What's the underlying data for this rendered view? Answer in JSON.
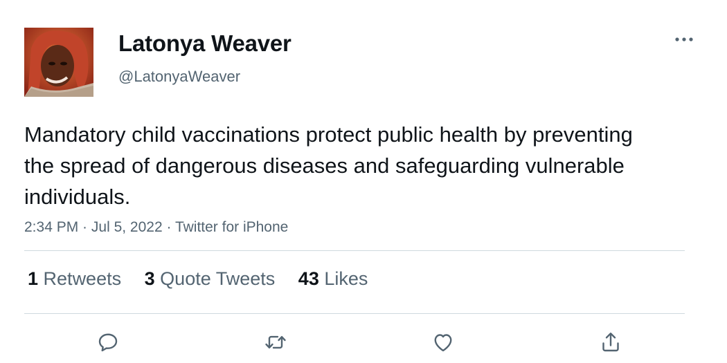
{
  "author": {
    "display_name": "Latonya Weaver",
    "handle": "@LatonyaWeaver",
    "avatar": "profile-photo"
  },
  "tweet": {
    "text": "Mandatory child vaccinations protect public health by preventing the spread of dangerous diseases and safeguarding vulnerable individuals.",
    "time": "2:34 PM",
    "date": "Jul 5, 2022",
    "source": "Twitter for iPhone",
    "separator": " · "
  },
  "stats": [
    {
      "count": "1",
      "label": "Retweets"
    },
    {
      "count": "3",
      "label": "Quote Tweets"
    },
    {
      "count": "43",
      "label": "Likes"
    }
  ],
  "actions": {
    "reply": "reply-icon",
    "retweet": "retweet-icon",
    "like": "heart-icon",
    "share": "share-icon"
  },
  "colors": {
    "text_primary": "#0f1419",
    "text_secondary": "#536471",
    "divider": "#cfd9de"
  }
}
